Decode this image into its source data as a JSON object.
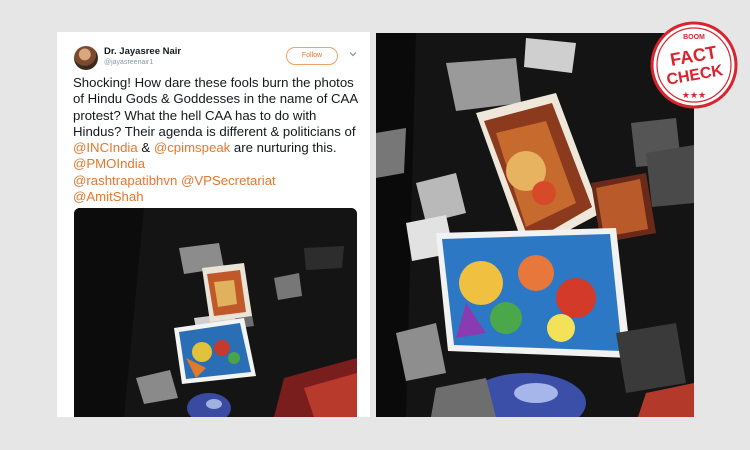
{
  "tweet": {
    "author_name": "Dr. Jayasree Nair",
    "author_handle": "@jayasreenair1",
    "follow_label": "Follow",
    "text_main": "Shocking! How dare these fools burn the photos of Hindu Gods & Goddesses in the name of CAA protest? What the hell CAA has to do with Hindus? Their agenda is different & politicians of ",
    "mention_1": "@INCIndia",
    "text_and": " & ",
    "mention_2": "@cpimspeak",
    "text_nurturing": " are nurturing this. ",
    "mention_3": "@PMOIndia",
    "mention_4": "@rashtrapatibhvn",
    "mention_5": "@VPSecretariat",
    "mention_6": "@AmitShah"
  },
  "badge": {
    "brand": "BOOM",
    "line1": "FACT",
    "line2": "CHECK",
    "stars": "★★★"
  },
  "colors": {
    "accent": "#e8762c",
    "badge_red": "#d9232e"
  },
  "icons": {
    "menu": "chevron-down-icon",
    "avatar": "avatar"
  }
}
